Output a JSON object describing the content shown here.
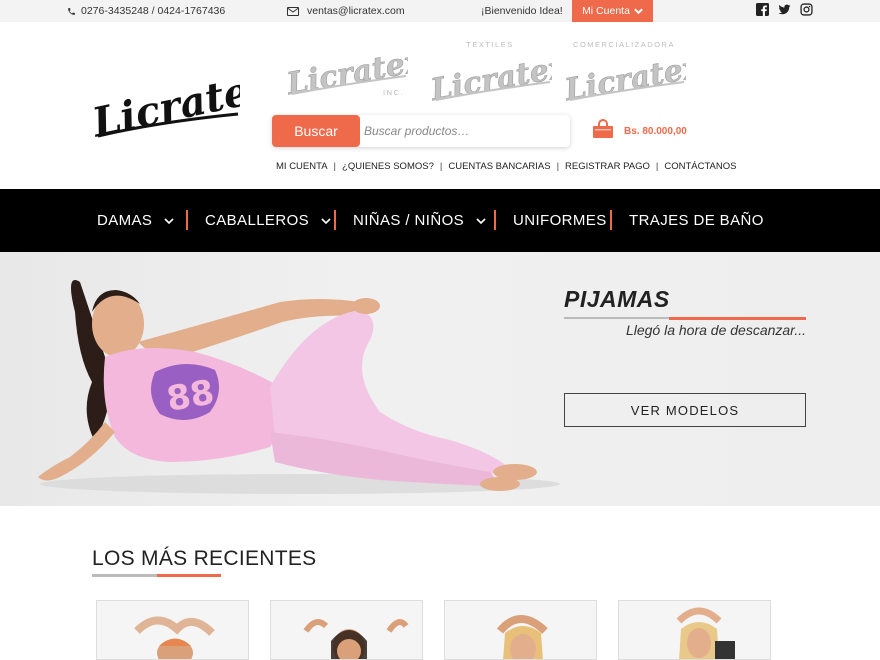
{
  "topbar": {
    "phone_icon": "phone-icon",
    "phones": "0276-3435248 / 0424-1767436",
    "email_icon": "envelope-icon",
    "email": "ventas@licratex.com",
    "welcome": "¡Bienvenido Idea!",
    "account_label": "Mi Cuenta",
    "social_icons": [
      "facebook-icon",
      "twitter-icon",
      "instagram-icon"
    ]
  },
  "header": {
    "logo_text": "Licratex",
    "sub_logos": [
      {
        "name": "Licratex",
        "tag_bottom": "INC."
      },
      {
        "name": "Licratex",
        "tag_top": "TEXTILES"
      },
      {
        "name": "Licratex",
        "tag_top": "COMERCIALIZADORA"
      }
    ],
    "search_button": "Buscar",
    "search_placeholder": "Buscar productos…",
    "cart_icon": "shopping-bag-icon",
    "cart_amount": "Bs. 80.000,00",
    "links": [
      "MI CUENTA",
      "¿QUIENES SOMOS?",
      "CUENTAS BANCARIAS",
      "REGISTRAR PAGO",
      "CONTÁCTANOS"
    ]
  },
  "nav": {
    "items": [
      {
        "label": "DAMAS",
        "has_dropdown": true
      },
      {
        "label": "CABALLEROS",
        "has_dropdown": true
      },
      {
        "label": "NIÑAS / NIÑOS",
        "has_dropdown": true
      },
      {
        "label": "UNIFORMES",
        "has_dropdown": false
      },
      {
        "label": "TRAJES DE BAÑO",
        "has_dropdown": false
      }
    ]
  },
  "hero": {
    "title": "PIJAMAS",
    "subtitle": "Llegó la hora de descanzar...",
    "button": "VER MODELOS"
  },
  "recent": {
    "title": "LOS MÁS RECIENTES"
  },
  "colors": {
    "accent": "#ef6a4b",
    "nav_bg": "#000000",
    "topbar_bg": "#f3f3f3"
  }
}
